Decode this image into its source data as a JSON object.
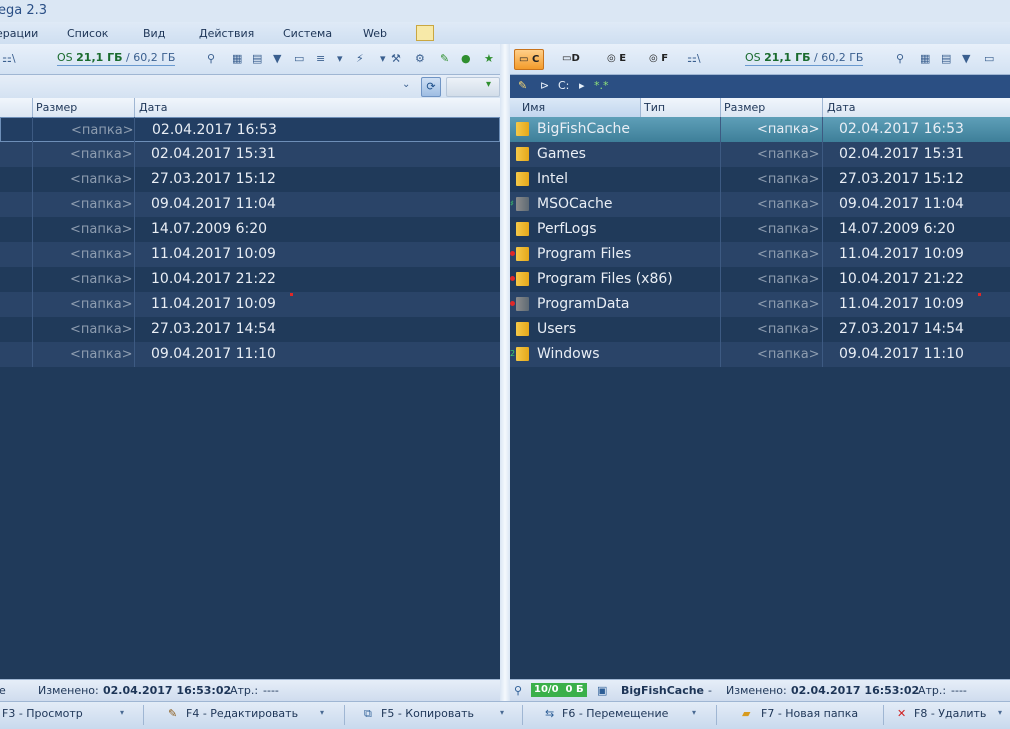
{
  "window": {
    "title": "ega 2.3"
  },
  "menu": [
    "ерации",
    "Список",
    "Вид",
    "Действия",
    "Система",
    "Web"
  ],
  "left_panel": {
    "drive_space": {
      "label": "OS",
      "free": "21,1 ГБ",
      "sep": " / ",
      "total": "60,2 ГБ"
    },
    "columns": {
      "size": "Размер",
      "date": "Дата"
    },
    "rows": [
      {
        "type": "<папка>",
        "date": "02.04.2017 16:53"
      },
      {
        "type": "<папка>",
        "date": "02.04.2017 15:31"
      },
      {
        "type": "<папка>",
        "date": "27.03.2017 15:12"
      },
      {
        "type": "<папка>",
        "date": "09.04.2017 11:04"
      },
      {
        "type": "<папка>",
        "date": "14.07.2009 6:20"
      },
      {
        "type": "<папка>",
        "date": "11.04.2017 10:09"
      },
      {
        "type": "<папка>",
        "date": "10.04.2017 21:22"
      },
      {
        "type": "<папка>",
        "date": "11.04.2017 10:09"
      },
      {
        "type": "<папка>",
        "date": "27.03.2017 14:54"
      },
      {
        "type": "<папка>",
        "date": "09.04.2017 11:10"
      }
    ],
    "status": {
      "prefix": "е",
      "changed_label": "Изменено:",
      "changed_value": "02.04.2017 16:53:02",
      "attr_label": "Атр.:",
      "attr_value": "----"
    }
  },
  "right_panel": {
    "drives": [
      "C",
      "D",
      "E",
      "F"
    ],
    "active_drive": "C",
    "drive_space": {
      "label": "OS",
      "free": "21,1 ГБ",
      "sep": " / ",
      "total": "60,2 ГБ"
    },
    "path": {
      "drive": "C:",
      "mask": "*.*"
    },
    "columns": {
      "name": "Имя",
      "type": "Тип",
      "size": "Размер",
      "date": "Дата"
    },
    "rows": [
      {
        "name": "BigFishCache",
        "type": "<папка>",
        "date": "02.04.2017 16:53"
      },
      {
        "name": "Games",
        "type": "<папка>",
        "date": "02.04.2017 15:31"
      },
      {
        "name": "Intel",
        "type": "<папка>",
        "date": "27.03.2017 15:12"
      },
      {
        "name": "MSOCache",
        "type": "<папка>",
        "date": "09.04.2017 11:04"
      },
      {
        "name": "PerfLogs",
        "type": "<папка>",
        "date": "14.07.2009 6:20"
      },
      {
        "name": "Program Files",
        "type": "<папка>",
        "date": "11.04.2017 10:09"
      },
      {
        "name": "Program Files (x86)",
        "type": "<папка>",
        "date": "10.04.2017 21:22"
      },
      {
        "name": "ProgramData",
        "type": "<папка>",
        "date": "11.04.2017 10:09"
      },
      {
        "name": "Users",
        "type": "<папка>",
        "date": "27.03.2017 14:54"
      },
      {
        "name": "Windows",
        "type": "<папка>",
        "date": "09.04.2017 11:10"
      }
    ],
    "status": {
      "counts": "10/0",
      "bytes": "0 Б",
      "selected": "BigFishCache",
      "dash": "-",
      "changed_label": "Изменено:",
      "changed_value": "02.04.2017 16:53:02",
      "attr_label": "Атр.:",
      "attr_value": "----"
    }
  },
  "function_keys": [
    "F3 - Просмотр",
    "F4 - Редактировать",
    "F5 - Копировать",
    "F6 - Перемещение",
    "F7 - Новая папка",
    "F8 - Удалить"
  ]
}
